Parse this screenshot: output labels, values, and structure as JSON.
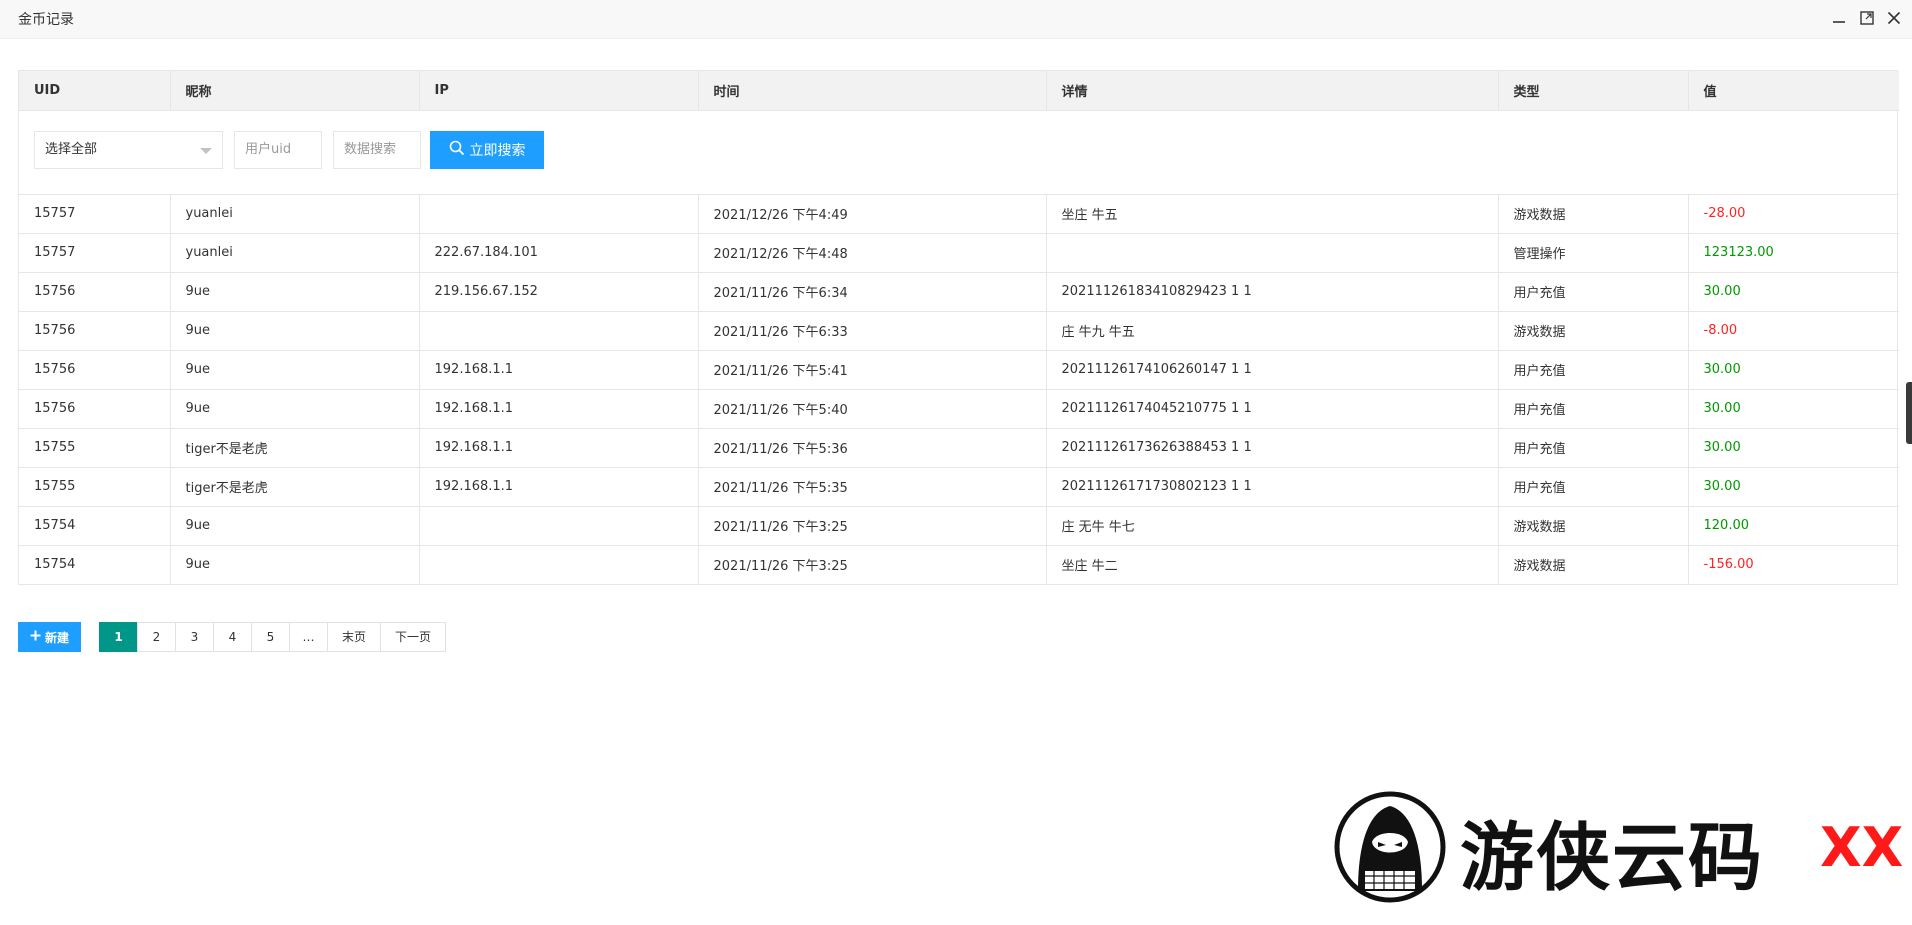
{
  "window": {
    "title": "金币记录"
  },
  "table": {
    "headers": [
      "UID",
      "昵称",
      "IP",
      "时间",
      "详情",
      "类型",
      "值"
    ],
    "rows": [
      {
        "uid": "15757",
        "nickname": "yuanlei",
        "ip": "",
        "time": "2021/12/26 下午4:49",
        "detail": "坐庄 牛五",
        "type": "游戏数据",
        "value": "-28.00",
        "value_sign": "neg"
      },
      {
        "uid": "15757",
        "nickname": "yuanlei",
        "ip": "222.67.184.101",
        "time": "2021/12/26 下午4:48",
        "detail": "",
        "type": "管理操作",
        "value": "123123.00",
        "value_sign": "pos"
      },
      {
        "uid": "15756",
        "nickname": "9ue",
        "ip": "219.156.67.152",
        "time": "2021/11/26 下午6:34",
        "detail": "20211126183410829423 1 1",
        "type": "用户充值",
        "value": "30.00",
        "value_sign": "pos"
      },
      {
        "uid": "15756",
        "nickname": "9ue",
        "ip": "",
        "time": "2021/11/26 下午6:33",
        "detail": "庄 牛九 牛五",
        "type": "游戏数据",
        "value": "-8.00",
        "value_sign": "neg"
      },
      {
        "uid": "15756",
        "nickname": "9ue",
        "ip": "192.168.1.1",
        "time": "2021/11/26 下午5:41",
        "detail": "20211126174106260147 1 1",
        "type": "用户充值",
        "value": "30.00",
        "value_sign": "pos"
      },
      {
        "uid": "15756",
        "nickname": "9ue",
        "ip": "192.168.1.1",
        "time": "2021/11/26 下午5:40",
        "detail": "20211126174045210775 1 1",
        "type": "用户充值",
        "value": "30.00",
        "value_sign": "pos"
      },
      {
        "uid": "15755",
        "nickname": "tiger不是老虎",
        "ip": "192.168.1.1",
        "time": "2021/11/26 下午5:36",
        "detail": "20211126173626388453 1 1",
        "type": "用户充值",
        "value": "30.00",
        "value_sign": "pos"
      },
      {
        "uid": "15755",
        "nickname": "tiger不是老虎",
        "ip": "192.168.1.1",
        "time": "2021/11/26 下午5:35",
        "detail": "20211126171730802123 1 1",
        "type": "用户充值",
        "value": "30.00",
        "value_sign": "pos"
      },
      {
        "uid": "15754",
        "nickname": "9ue",
        "ip": "",
        "time": "2021/11/26 下午3:25",
        "detail": "庄 无牛 牛七",
        "type": "游戏数据",
        "value": "120.00",
        "value_sign": "pos"
      },
      {
        "uid": "15754",
        "nickname": "9ue",
        "ip": "",
        "time": "2021/11/26 下午3:25",
        "detail": "坐庄 牛二",
        "type": "游戏数据",
        "value": "-156.00",
        "value_sign": "neg"
      }
    ]
  },
  "filters": {
    "type_select": "选择全部",
    "uid_placeholder": "用户uid",
    "data_placeholder": "数据搜索",
    "search_label": "立即搜索"
  },
  "actions": {
    "new_label": "新建"
  },
  "pagination": {
    "pages": [
      "1",
      "2",
      "3",
      "4",
      "5"
    ],
    "active_page": "1",
    "ellipsis": "…",
    "last_label": "末页",
    "next_label": "下一页"
  },
  "colors": {
    "accent": "#1e9fff",
    "pager_active": "#009688",
    "negative": "#ff2222",
    "positive": "#009900"
  },
  "watermark": {
    "text": "游侠云码",
    "accent_text": "XX"
  }
}
